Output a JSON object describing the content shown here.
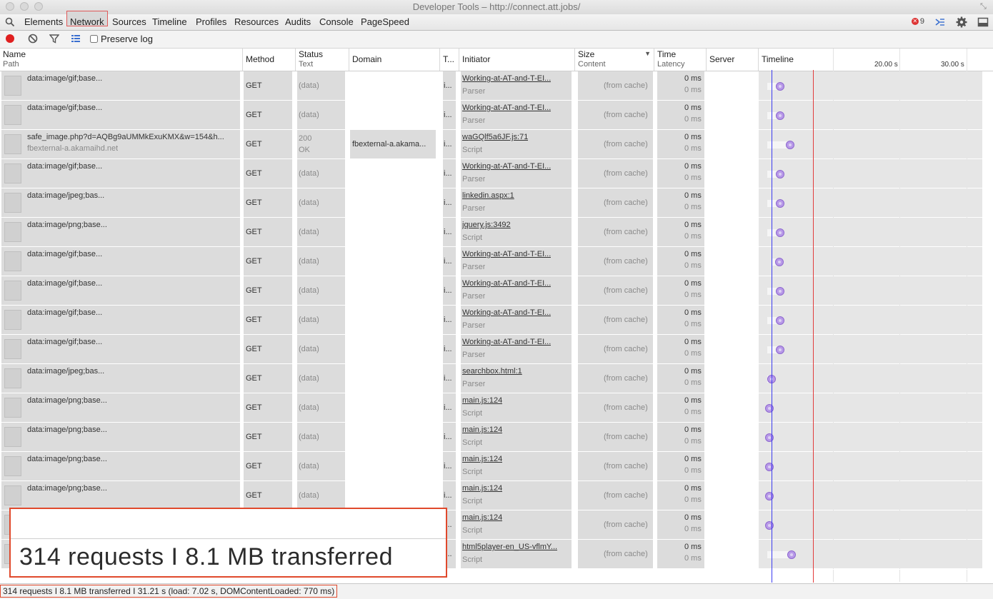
{
  "window": {
    "title": "Developer Tools – http://connect.att.jobs/"
  },
  "tabs": [
    "Elements",
    "Network",
    "Sources",
    "Timeline",
    "Profiles",
    "Resources",
    "Audits",
    "Console",
    "PageSpeed"
  ],
  "active_tab": "Network",
  "error_count": "9",
  "toolbar": {
    "preserve_log_label": "Preserve log"
  },
  "columns": {
    "name": {
      "title": "Name",
      "sub": "Path"
    },
    "method": {
      "title": "Method"
    },
    "status": {
      "title": "Status",
      "sub": "Text"
    },
    "domain": {
      "title": "Domain"
    },
    "type": {
      "title": "T..."
    },
    "initiator": {
      "title": "Initiator"
    },
    "size": {
      "title": "Size",
      "sub": "Content"
    },
    "time": {
      "title": "Time",
      "sub": "Latency"
    },
    "server": {
      "title": "Server"
    },
    "timeline": {
      "title": "Timeline",
      "ticks": [
        "20.00 s",
        "30.00 s"
      ]
    }
  },
  "rows": [
    {
      "name": "data:image/gif;base...",
      "path": "",
      "method": "GET",
      "status": "(data)",
      "status_text": "",
      "domain": "",
      "type": "i...",
      "initiator": "Working-at-AT-and-T-EI...",
      "initiator_type": "Parser",
      "size": "(from cache)",
      "time": "0 ms",
      "latency": "0 ms"
    },
    {
      "name": "data:image/gif;base...",
      "path": "",
      "method": "GET",
      "status": "(data)",
      "status_text": "",
      "domain": "",
      "type": "i...",
      "initiator": "Working-at-AT-and-T-EI...",
      "initiator_type": "Parser",
      "size": "(from cache)",
      "time": "0 ms",
      "latency": "0 ms"
    },
    {
      "name": "safe_image.php?d=AQBg9aUMMkExuKMX&w=154&h...",
      "path": "fbexternal-a.akamaihd.net",
      "method": "GET",
      "status": "200",
      "status_text": "OK",
      "domain": "fbexternal-a.akama...",
      "type": "i...",
      "initiator": "waGQlf5a6JF.js:71",
      "initiator_type": "Script",
      "size": "(from cache)",
      "time": "0 ms",
      "latency": "0 ms"
    },
    {
      "name": "data:image/gif;base...",
      "path": "",
      "method": "GET",
      "status": "(data)",
      "status_text": "",
      "domain": "",
      "type": "i...",
      "initiator": "Working-at-AT-and-T-EI...",
      "initiator_type": "Parser",
      "size": "(from cache)",
      "time": "0 ms",
      "latency": "0 ms"
    },
    {
      "name": "data:image/jpeg;bas...",
      "path": "",
      "method": "GET",
      "status": "(data)",
      "status_text": "",
      "domain": "",
      "type": "i...",
      "initiator": "linkedin.aspx:1",
      "initiator_type": "Parser",
      "size": "(from cache)",
      "time": "0 ms",
      "latency": "0 ms"
    },
    {
      "name": "data:image/png;base...",
      "path": "",
      "method": "GET",
      "status": "(data)",
      "status_text": "",
      "domain": "",
      "type": "i...",
      "initiator": "jquery.js:3492",
      "initiator_type": "Script",
      "size": "(from cache)",
      "time": "0 ms",
      "latency": "0 ms"
    },
    {
      "name": "data:image/gif;base...",
      "path": "",
      "method": "GET",
      "status": "(data)",
      "status_text": "",
      "domain": "",
      "type": "i...",
      "initiator": "Working-at-AT-and-T-EI...",
      "initiator_type": "Parser",
      "size": "(from cache)",
      "time": "0 ms",
      "latency": "0 ms"
    },
    {
      "name": "data:image/gif;base...",
      "path": "",
      "method": "GET",
      "status": "(data)",
      "status_text": "",
      "domain": "",
      "type": "i...",
      "initiator": "Working-at-AT-and-T-EI...",
      "initiator_type": "Parser",
      "size": "(from cache)",
      "time": "0 ms",
      "latency": "0 ms"
    },
    {
      "name": "data:image/gif;base...",
      "path": "",
      "method": "GET",
      "status": "(data)",
      "status_text": "",
      "domain": "",
      "type": "i...",
      "initiator": "Working-at-AT-and-T-EI...",
      "initiator_type": "Parser",
      "size": "(from cache)",
      "time": "0 ms",
      "latency": "0 ms"
    },
    {
      "name": "data:image/gif;base...",
      "path": "",
      "method": "GET",
      "status": "(data)",
      "status_text": "",
      "domain": "",
      "type": "i...",
      "initiator": "Working-at-AT-and-T-EI...",
      "initiator_type": "Parser",
      "size": "(from cache)",
      "time": "0 ms",
      "latency": "0 ms"
    },
    {
      "name": "data:image/jpeg;bas...",
      "path": "",
      "method": "GET",
      "status": "(data)",
      "status_text": "",
      "domain": "",
      "type": "i...",
      "initiator": "searchbox.html:1",
      "initiator_type": "Parser",
      "size": "(from cache)",
      "time": "0 ms",
      "latency": "0 ms"
    },
    {
      "name": "data:image/png;base...",
      "path": "",
      "method": "GET",
      "status": "(data)",
      "status_text": "",
      "domain": "",
      "type": "i...",
      "initiator": "main.js:124",
      "initiator_type": "Script",
      "size": "(from cache)",
      "time": "0 ms",
      "latency": "0 ms"
    },
    {
      "name": "data:image/png;base...",
      "path": "",
      "method": "GET",
      "status": "(data)",
      "status_text": "",
      "domain": "",
      "type": "i...",
      "initiator": "main.js:124",
      "initiator_type": "Script",
      "size": "(from cache)",
      "time": "0 ms",
      "latency": "0 ms"
    },
    {
      "name": "data:image/png;base...",
      "path": "",
      "method": "GET",
      "status": "(data)",
      "status_text": "",
      "domain": "",
      "type": "i...",
      "initiator": "main.js:124",
      "initiator_type": "Script",
      "size": "(from cache)",
      "time": "0 ms",
      "latency": "0 ms"
    },
    {
      "name": "data:image/png;base...",
      "path": "",
      "method": "GET",
      "status": "(data)",
      "status_text": "",
      "domain": "",
      "type": "i...",
      "initiator": "main.js:124",
      "initiator_type": "Script",
      "size": "(from cache)",
      "time": "0 ms",
      "latency": "0 ms"
    },
    {
      "name": "",
      "path": "",
      "method": "",
      "status": "",
      "status_text": "",
      "domain": "",
      "type": "i...",
      "initiator": "main.js:124",
      "initiator_type": "Script",
      "size": "(from cache)",
      "time": "0 ms",
      "latency": "0 ms"
    },
    {
      "name": "",
      "path": "",
      "method": "",
      "status": "",
      "status_text": "",
      "domain": "",
      "type": "i...",
      "initiator": "html5player-en_US-vflmY...",
      "initiator_type": "Script",
      "size": "(from cache)",
      "time": "0 ms",
      "latency": "0 ms"
    }
  ],
  "zoom_callout": "314 requests I 8.1 MB transferred",
  "status_bar": "314 requests I 8.1 MB transferred I 31.21 s (load: 7.02 s, DOMContentLoaded: 770 ms)",
  "colors": {
    "load_line": "#e23b3b",
    "dom_line": "#3b3bf0",
    "accent": "#e0492c"
  }
}
